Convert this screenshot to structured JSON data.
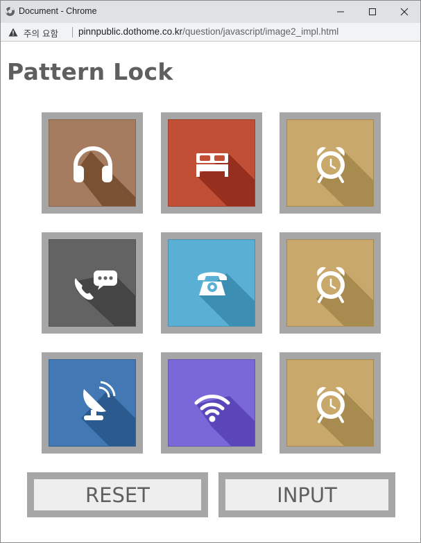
{
  "browser": {
    "window_title": "Document - Chrome",
    "security_warning": "주의 요함",
    "url_host": "pinnpublic.dothome.co.kr",
    "url_path": "/question/javascript/image2_impl.html"
  },
  "page": {
    "title": "Pattern Lock"
  },
  "tiles": [
    {
      "icon": "headphones-icon",
      "color": "#a57c5f",
      "shadow": "#7a5233"
    },
    {
      "icon": "bed-icon",
      "color": "#c14f36",
      "shadow": "#962f1e"
    },
    {
      "icon": "alarm-clock-icon",
      "color": "#c8a86b",
      "shadow": "#a88b4e"
    },
    {
      "icon": "phone-chat-icon",
      "color": "#636363",
      "shadow": "#454545"
    },
    {
      "icon": "telephone-icon",
      "color": "#5ab0d4",
      "shadow": "#3c8fb3"
    },
    {
      "icon": "alarm-clock-icon",
      "color": "#c8a86b",
      "shadow": "#a88b4e"
    },
    {
      "icon": "satellite-dish-icon",
      "color": "#4278b3",
      "shadow": "#2b5a8e"
    },
    {
      "icon": "wifi-icon",
      "color": "#7b68d8",
      "shadow": "#5a46b8"
    },
    {
      "icon": "alarm-clock-icon",
      "color": "#c8a86b",
      "shadow": "#a88b4e"
    }
  ],
  "buttons": {
    "reset_label": "RESET",
    "input_label": "INPUT"
  }
}
